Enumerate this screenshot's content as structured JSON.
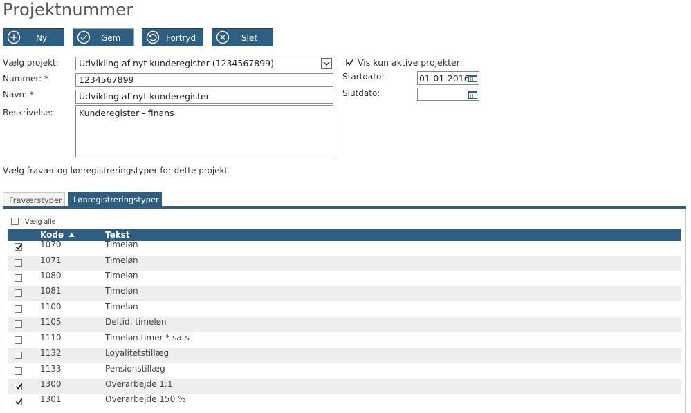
{
  "page": {
    "title": "Projektnummer"
  },
  "toolbar": {
    "new_label": "Ny",
    "save_label": "Gem",
    "undo_label": "Fortryd",
    "delete_label": "Slet"
  },
  "form": {
    "project_label": "Vælg projekt:",
    "project_value": "Udvikling af nyt kunderegister (1234567899)",
    "number_label": "Nummer: *",
    "number_value": "1234567899",
    "name_label": "Navn: *",
    "name_value": "Udvikling af nyt kunderegister",
    "description_label": "Beskrivelse:",
    "description_value": "Kunderegister - finans",
    "only_active_label": "Vis kun aktive projekter",
    "only_active_checked": true,
    "start_label": "Startdato:",
    "start_value": "01-01-2016",
    "end_label": "Slutdato:",
    "end_value": ""
  },
  "section": {
    "subtitle": "Vælg fravær og lønregistreringstyper for dette projekt"
  },
  "tabs": [
    {
      "label": "Fraværstyper",
      "active": false
    },
    {
      "label": "Lønregistreringstyper",
      "active": true
    }
  ],
  "table": {
    "select_all_label": "Vælg alle",
    "headers": {
      "code": "Kode",
      "text": "Tekst"
    },
    "rows": [
      {
        "code": "1070",
        "text": "Timeløn",
        "checked": true
      },
      {
        "code": "1071",
        "text": "Timeløn",
        "checked": false
      },
      {
        "code": "1080",
        "text": "Timeløn",
        "checked": false
      },
      {
        "code": "1081",
        "text": "Timeløn",
        "checked": false
      },
      {
        "code": "1100",
        "text": "Timeløn",
        "checked": false
      },
      {
        "code": "1105",
        "text": "Deltid, timeløn",
        "checked": false
      },
      {
        "code": "1110",
        "text": "Timeløn timer * sats",
        "checked": false
      },
      {
        "code": "1132",
        "text": "Loyalitetstillæg",
        "checked": false
      },
      {
        "code": "1133",
        "text": "Pensionstillæg",
        "checked": false
      },
      {
        "code": "1300",
        "text": "Overarbejde 1:1",
        "checked": true
      },
      {
        "code": "1301",
        "text": "Overarbejde 150 %",
        "checked": true
      }
    ]
  },
  "colors": {
    "accent": "#2e5f80",
    "row_alt": "#eeeeee"
  }
}
